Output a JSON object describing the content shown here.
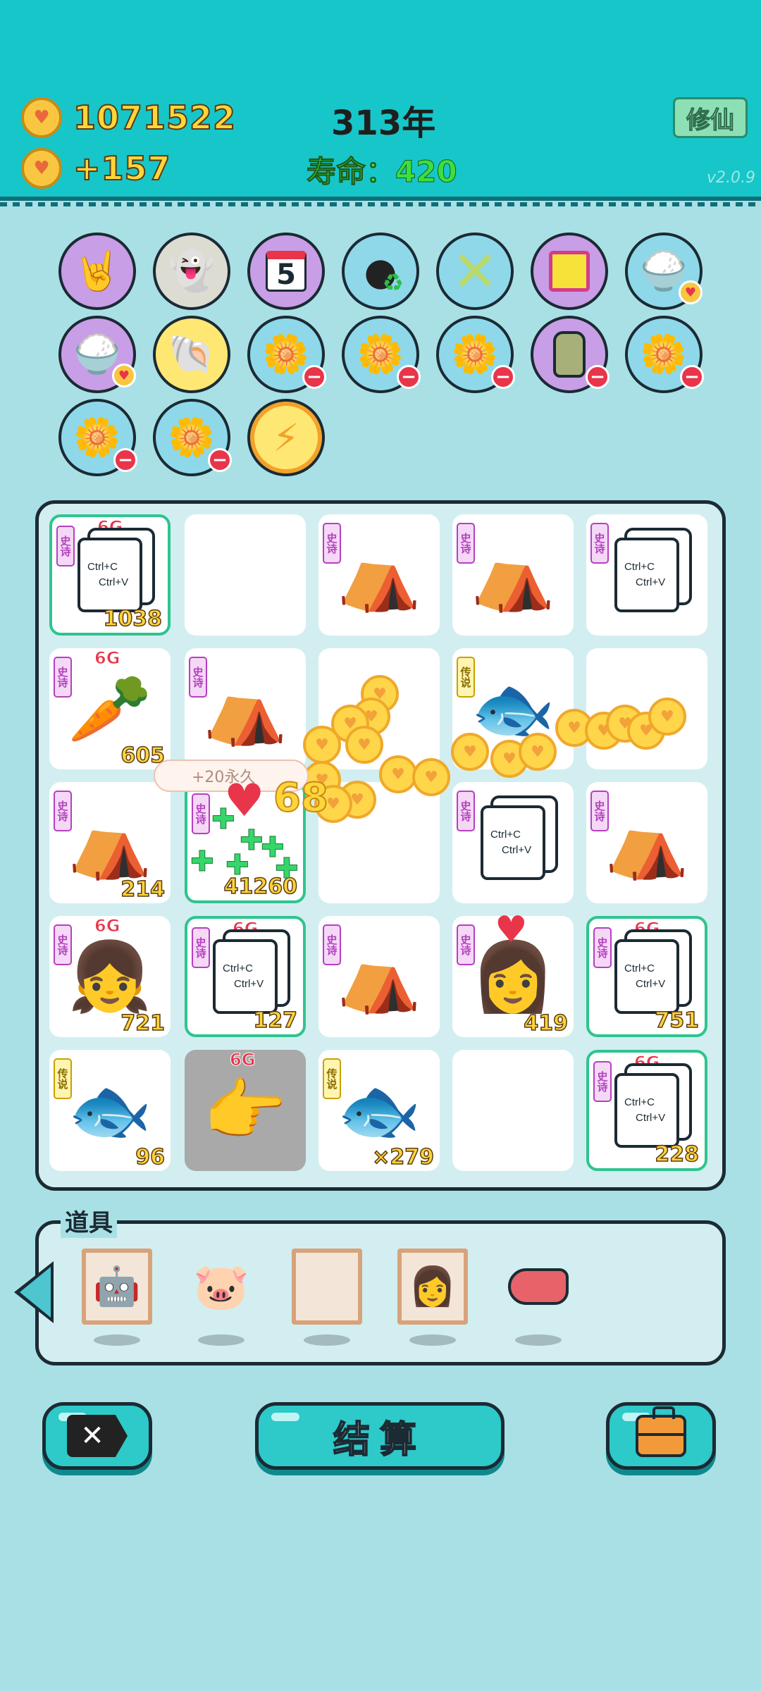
{
  "header": {
    "coins": "1071522",
    "income": "+157",
    "year": "313年",
    "lifespan": "寿命：420",
    "xiuxian_button": "修仙",
    "version": "v2.0.9"
  },
  "orb_icons": [
    {
      "name": "rock-hand-icon",
      "glyph": "🤘",
      "color": "purple"
    },
    {
      "name": "ghost-icon",
      "glyph": "👻",
      "color": "gray"
    },
    {
      "name": "calendar-icon",
      "glyph": "📅",
      "color": "purple"
    },
    {
      "name": "recycle-bag-icon",
      "glyph": "♻",
      "color": "blue"
    },
    {
      "name": "chopsticks-icon",
      "glyph": "✕",
      "color": "blue"
    },
    {
      "name": "tv-icon",
      "glyph": "📺",
      "color": "purple"
    },
    {
      "name": "rice-bowl-icon",
      "glyph": "🍚",
      "color": "blue"
    },
    {
      "name": "rice-bowl-icon",
      "glyph": "🍚",
      "color": "purple"
    },
    {
      "name": "shell-icon",
      "glyph": "🐚",
      "color": "yellow"
    },
    {
      "name": "potted-flower-icon",
      "glyph": "🌼",
      "color": "blue"
    },
    {
      "name": "potted-flower-icon",
      "glyph": "🌼",
      "color": "blue"
    },
    {
      "name": "potted-flower-icon",
      "glyph": "🌼",
      "color": "blue"
    },
    {
      "name": "garbage-bag-icon",
      "glyph": "🛍",
      "color": "purple"
    },
    {
      "name": "potted-flower-icon",
      "glyph": "🌼",
      "color": "blue"
    },
    {
      "name": "potted-flower-icon",
      "glyph": "🌼",
      "color": "blue"
    },
    {
      "name": "potted-flower-icon",
      "glyph": "🌼",
      "color": "blue"
    },
    {
      "name": "lightning-icon",
      "glyph": "⚡",
      "color": "yellow"
    }
  ],
  "board": {
    "tag_epic": "史诗",
    "tag_legend": "传说",
    "sixg": "6G",
    "ctrl_c": "Ctrl+C",
    "ctrl_v": "Ctrl+V",
    "counts": {
      "r1c1": "1038",
      "r2c1": "605",
      "r3c1": "214",
      "r3c2": "41260",
      "r4c1": "721",
      "r4c2": "127",
      "r4c4": "419",
      "r4c5": "751",
      "r5c1": "96",
      "r5c3": "×279",
      "r5c5": "228"
    },
    "float_label": "+20永久",
    "float_number": "68"
  },
  "tools": {
    "title": "道具"
  },
  "buttons": {
    "settle": "结算",
    "exit": "✕"
  }
}
